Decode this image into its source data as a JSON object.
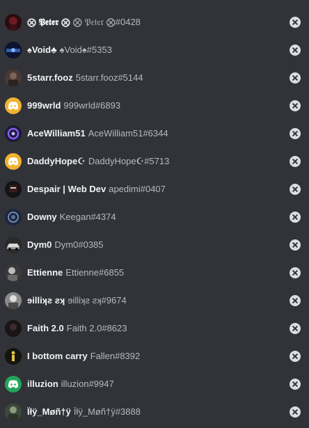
{
  "users": [
    {
      "display_name": "⨂ 𝕻𝖊𝖙𝖊𝖗 ⨂",
      "tag": "⨂ 𝔓𝔢𝔱𝔢𝔯 ⨂#0428",
      "avatar": "dark-red-avatar",
      "avatar_color": "#2a0c10"
    },
    {
      "display_name": "♠Void♣",
      "tag": "♠Void♠#5353",
      "avatar": "void-avatar",
      "avatar_color": "#0d1430"
    },
    {
      "display_name": "5starr.fooz",
      "tag": "5starr.fooz#5144",
      "avatar": "photo-avatar",
      "avatar_color": "#4a3a33"
    },
    {
      "display_name": "999wrld",
      "tag": "999wrld#6893",
      "avatar": "discord-default-avatar",
      "avatar_color": "#f0b232"
    },
    {
      "display_name": "AceWilliam51",
      "tag": "AceWilliam51#6344",
      "avatar": "purple-logo-avatar",
      "avatar_color": "#1b1b3a"
    },
    {
      "display_name": "DaddyHope☪",
      "tag": "DaddyHope☪#5713",
      "avatar": "discord-default-avatar",
      "avatar_color": "#f0b232"
    },
    {
      "display_name": "Despair | Web Dev",
      "tag": "apedimi#0407",
      "avatar": "dark-avatar",
      "avatar_color": "#141414"
    },
    {
      "display_name": "Downy",
      "tag": "Keegan#4374",
      "avatar": "circle-logo-avatar",
      "avatar_color": "#1d2740"
    },
    {
      "display_name": "Dym0",
      "tag": "Dym0#0385",
      "avatar": "car-avatar",
      "avatar_color": "#2a2a2a"
    },
    {
      "display_name": "Ettienne",
      "tag": "Ettienne#6855",
      "avatar": "bw-photo-avatar",
      "avatar_color": "#3a3a3a"
    },
    {
      "display_name": "ɘilliʞƨ ƨʞ",
      "tag": "ɘilliʞƨ ƨʞ#9674",
      "avatar": "portrait-avatar",
      "avatar_color": "#8a8a8a"
    },
    {
      "display_name": "Faith 2.0",
      "tag": "Faith 2.0#8623",
      "avatar": "dark-avatar",
      "avatar_color": "#1a1416"
    },
    {
      "display_name": "I bottom carry",
      "tag": "Fallen#8392",
      "avatar": "yellow-figure-avatar",
      "avatar_color": "#151510"
    },
    {
      "display_name": "illuzion",
      "tag": "illuzion#9947",
      "avatar": "discord-default-avatar",
      "avatar_color": "#23a55a"
    },
    {
      "display_name": "Ïłÿ_Møñ†ÿ",
      "tag": "Ïłÿ_Møñ†ÿ#3888",
      "avatar": "photo-avatar",
      "avatar_color": "#3b4a3a"
    }
  ],
  "remove_icon": "close-circle-icon"
}
